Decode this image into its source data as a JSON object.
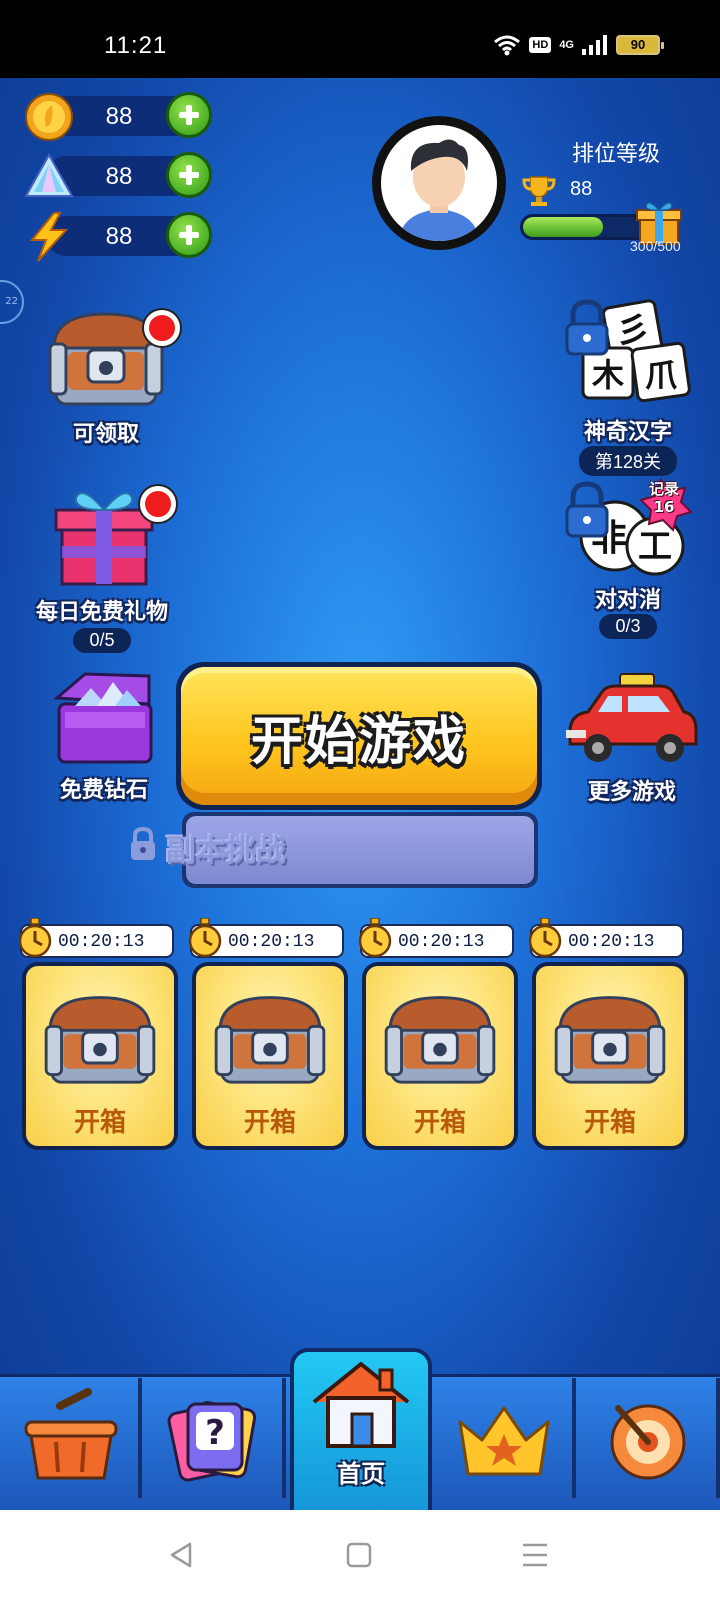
{
  "status_bar": {
    "time": "11:21",
    "hd": "HD",
    "network": "4G",
    "battery": "90"
  },
  "resources": {
    "coins": "88",
    "diamonds": "88",
    "energy": "88"
  },
  "rank": {
    "title": "排位等级",
    "trophies": "88",
    "progress_text": "300/500",
    "progress_fraction": 0.6
  },
  "side_handle": "22",
  "features": {
    "claimable": {
      "label": "可领取"
    },
    "daily_gift": {
      "label": "每日免费礼物",
      "count": "0/5"
    },
    "free_diamonds": {
      "label": "免费钻石"
    },
    "magic_chars": {
      "label": "神奇汉字",
      "level": "第128关",
      "tiles": [
        "彡",
        "木",
        "爪"
      ]
    },
    "match_game": {
      "label": "对对消",
      "count": "0/3",
      "record_label": "记录",
      "record_value": "16",
      "tiles": [
        "非",
        "工"
      ]
    },
    "more_games": {
      "label": "更多游戏"
    }
  },
  "main": {
    "start_label": "开始游戏",
    "dungeon_label": "副本挑战"
  },
  "chest_slots": [
    {
      "timer": "00:20:13",
      "label": "开箱"
    },
    {
      "timer": "00:20:13",
      "label": "开箱"
    },
    {
      "timer": "00:20:13",
      "label": "开箱"
    },
    {
      "timer": "00:20:13",
      "label": "开箱"
    }
  ],
  "bottom_nav": {
    "shop": "basket-icon",
    "quiz": "question-cards-icon",
    "home_label": "首页",
    "ranking": "crown-icon",
    "target": "target-icon"
  },
  "colors": {
    "background": "#1d6fd8",
    "start_button": "#ffc61e",
    "chest_card": "#fde37a",
    "plus_button": "#2f9a16"
  }
}
